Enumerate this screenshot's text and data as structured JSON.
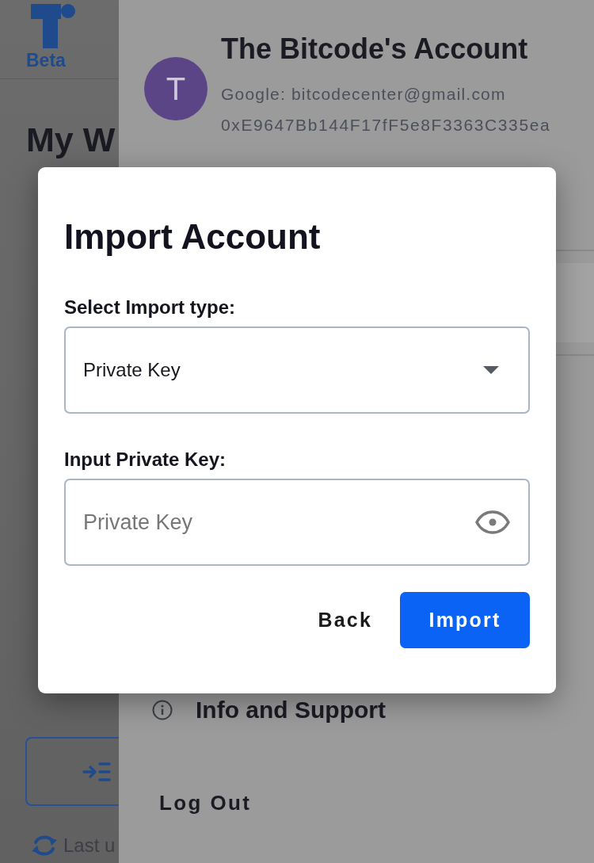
{
  "background_page": {
    "logo": {
      "badge": "Beta"
    },
    "heading": "My W",
    "last_updated": "Last u"
  },
  "drawer": {
    "account": {
      "avatar_letter": "T",
      "name": "The Bitcode's Account",
      "login": "Google: bitcodecenter@gmail.com",
      "address": "0xE9647Bb144F17fF5e8F3363C335ea"
    },
    "menu_items": [
      {
        "kind": "info",
        "label": "Info and Support"
      },
      {
        "kind": "plain",
        "label": "Log Out"
      }
    ]
  },
  "dialog": {
    "title": "Import Account",
    "type_label": "Select Import type:",
    "type_select": {
      "value": "Private Key"
    },
    "key_label": "Input Private Key:",
    "key_input": {
      "placeholder": "Private Key"
    },
    "buttons": [
      {
        "kind": "text",
        "label": "Back"
      },
      {
        "kind": "primary",
        "label": "Import"
      }
    ]
  }
}
